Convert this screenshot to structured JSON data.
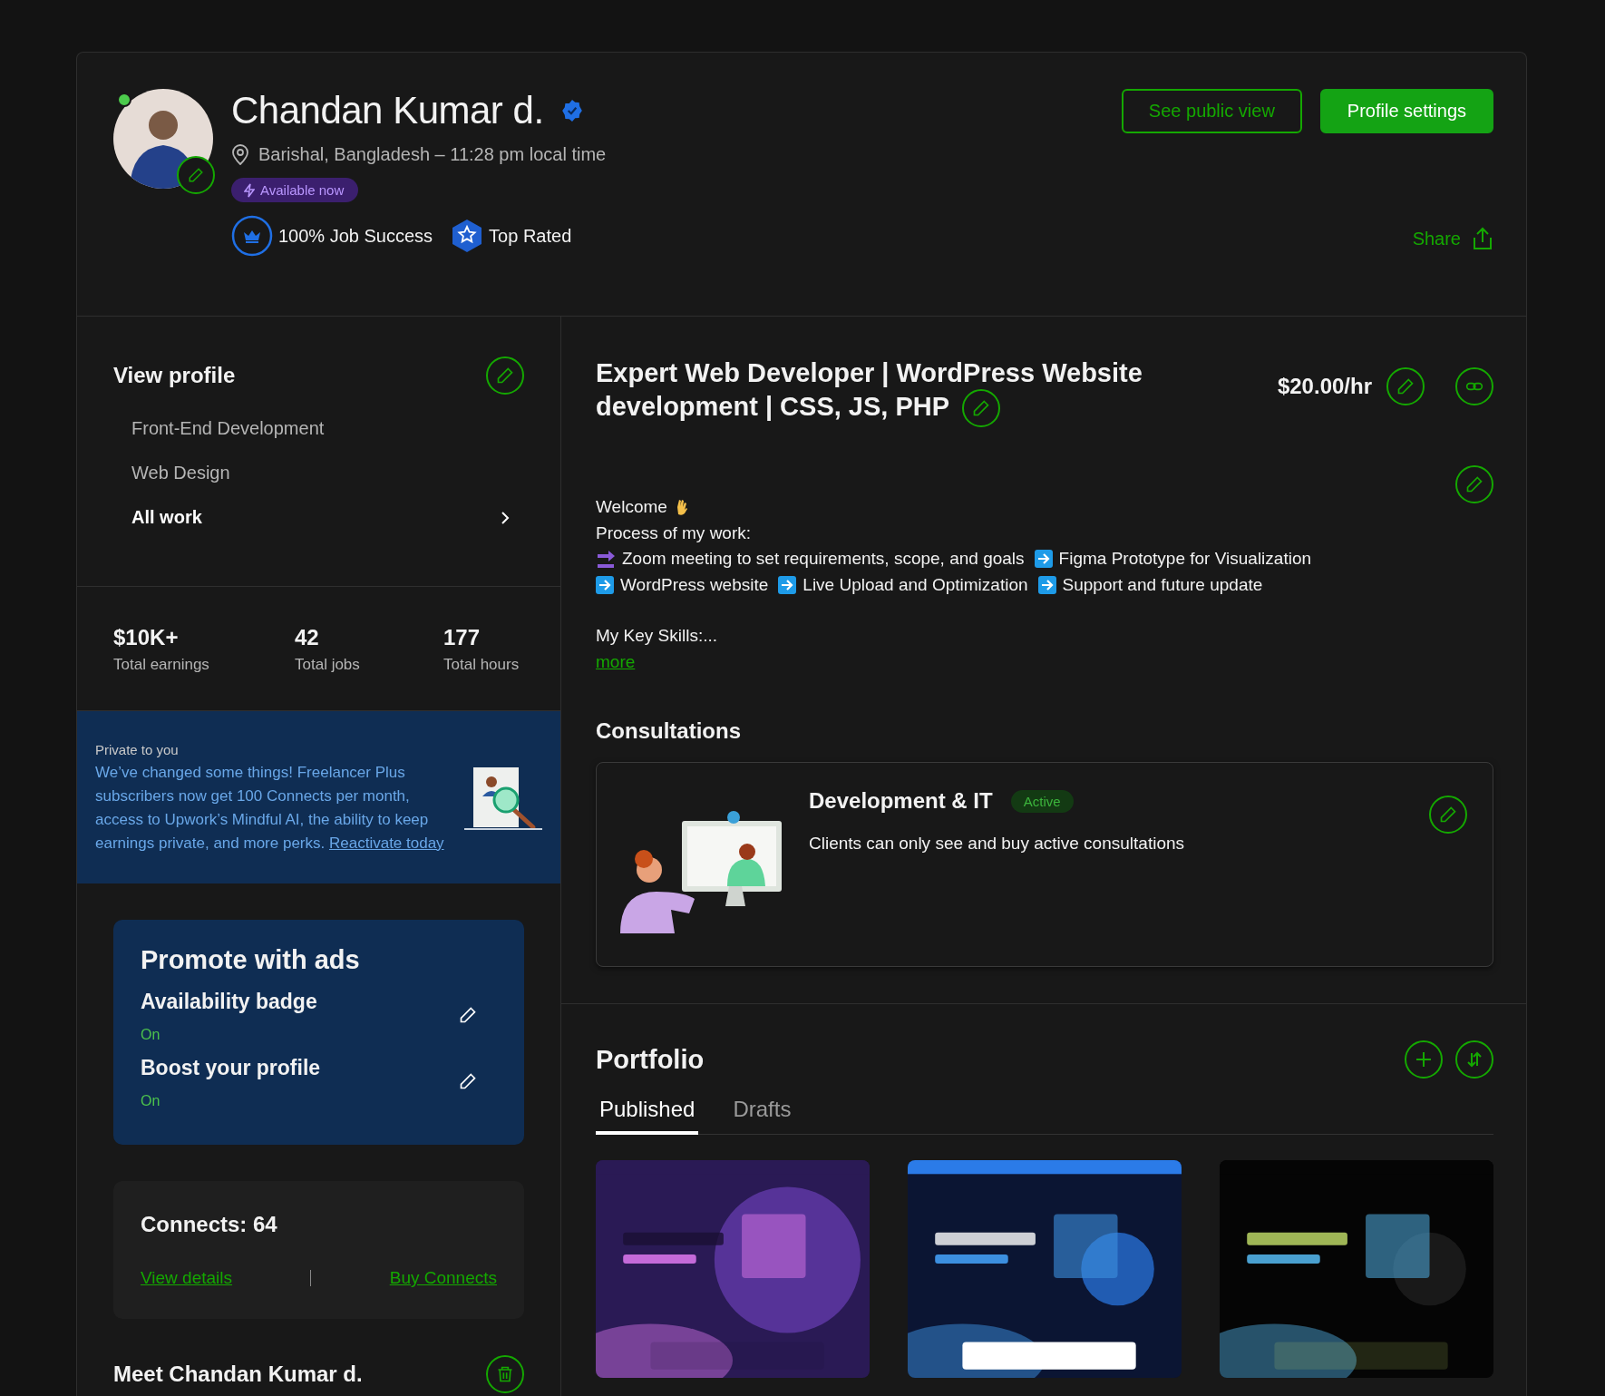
{
  "profile": {
    "name": "Chandan Kumar d.",
    "online": true,
    "verified": true,
    "location": "Barishal, Bangladesh – 11:28 pm local time",
    "availability": "Available now",
    "badges": [
      {
        "kind": "job_success",
        "label": "100% Job Success"
      },
      {
        "kind": "top_rated",
        "label": "Top Rated"
      }
    ]
  },
  "header_buttons": [
    {
      "label": "See public view",
      "kind": "outline"
    },
    {
      "label": "Profile settings",
      "kind": "primary"
    }
  ],
  "share": "Share",
  "sidebar": {
    "title": "View profile",
    "items": [
      {
        "label": "Front-End Development",
        "selected": false
      },
      {
        "label": "Web Design",
        "selected": false
      },
      {
        "label": "All work",
        "selected": true
      }
    ]
  },
  "stats": [
    {
      "value": "$10K+",
      "label": "Total earnings"
    },
    {
      "value": "42",
      "label": "Total jobs"
    },
    {
      "value": "177",
      "label": "Total hours"
    }
  ],
  "notice": {
    "caption": "Private to you",
    "text": "We’ve changed some things! Freelancer Plus subscribers now get 100 Connects per month, access to Upwork’s Mindful AI, the ability to keep earnings private, and more perks.",
    "link": "Reactivate today"
  },
  "promote": {
    "title": "Promote with ads",
    "items": [
      {
        "label": "Availability badge",
        "status": "On",
        "on": true
      },
      {
        "label": "Boost your profile",
        "status": "On",
        "on": true
      }
    ]
  },
  "connects": {
    "title": "Connects: 64",
    "links": [
      "View details",
      "Buy Connects"
    ]
  },
  "meet": "Meet Chandan Kumar d.",
  "headline": "Expert Web Developer | WordPress Website development | CSS, JS, PHP",
  "rate": "$20.00/hr",
  "overview": {
    "greeting": "Welcome",
    "intro": "Process of my work:",
    "lines": [
      [
        {
          "kind": "soon",
          "text": "Zoom meeting to set requirements, scope, and goals"
        },
        {
          "kind": "arrow",
          "text": "Figma Prototype for Visualization"
        }
      ],
      [
        {
          "kind": "arrow",
          "text": "WordPress website"
        },
        {
          "kind": "arrow",
          "text": "Live Upload and Optimization"
        },
        {
          "kind": "arrow",
          "text": "Support and future update"
        }
      ]
    ],
    "skills": "My Key Skills:...",
    "more": "more"
  },
  "consultations": {
    "title": "Consultations",
    "items": [
      {
        "title": "Development & IT",
        "status": "Active",
        "active": true,
        "description": "Clients can only see and buy active consultations"
      }
    ]
  },
  "portfolio": {
    "title": "Portfolio",
    "tabs": [
      {
        "label": "Published",
        "selected": true
      },
      {
        "label": "Drafts",
        "selected": false
      }
    ]
  }
}
